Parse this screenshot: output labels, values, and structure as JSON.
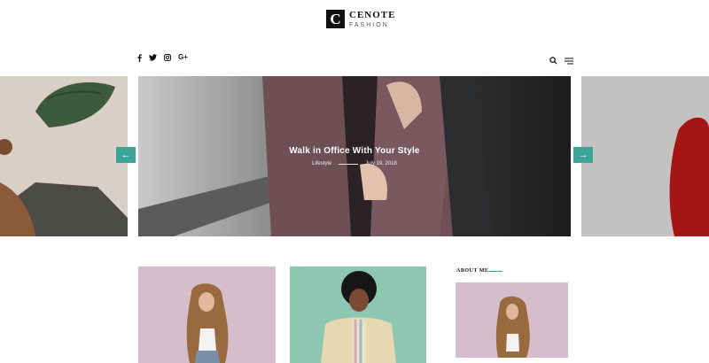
{
  "brand": {
    "logo_letter": "C",
    "title": "CENOTE",
    "subtitle": "FASHION"
  },
  "social": [
    {
      "icon": "facebook-icon",
      "glyph": "f"
    },
    {
      "icon": "twitter-icon",
      "glyph": "t"
    },
    {
      "icon": "instagram-icon",
      "glyph": "ig"
    },
    {
      "icon": "google-plus-icon",
      "glyph": "G+"
    }
  ],
  "tools": {
    "search_icon": "search-icon",
    "menu_icon": "menu-icon"
  },
  "slider": {
    "title": "Walk in Office With Your Style",
    "category": "Lifestyle",
    "date": "July 19, 2018",
    "prev_arrow": "←",
    "next_arrow": "→"
  },
  "sidebar": {
    "about_title": "ABOUT ME"
  },
  "colors": {
    "accent": "#3aa597",
    "text": "#111111"
  }
}
